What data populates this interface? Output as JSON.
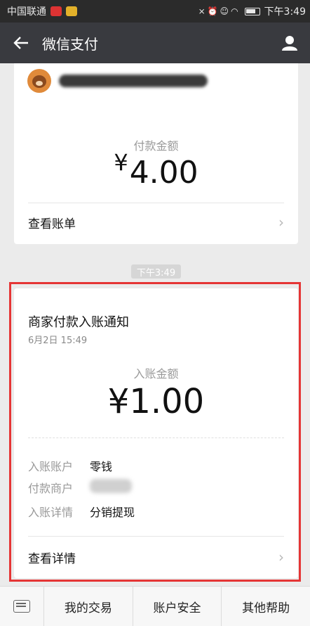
{
  "statusbar": {
    "carrier": "中国联通",
    "time": "下午3:49"
  },
  "navbar": {
    "title": "微信支付"
  },
  "card1": {
    "amount_label": "付款金额",
    "currency": "¥",
    "amount": "4.00",
    "link": "查看账单"
  },
  "time_chip": "下午3:49",
  "card2": {
    "title": "商家付款入账通知",
    "date": "6月2日  15:49",
    "amount_label": "入账金额",
    "amount": "¥1.00",
    "rows": [
      {
        "key": "入账账户",
        "value": "零钱"
      },
      {
        "key": "付款商户",
        "value": ""
      },
      {
        "key": "入账详情",
        "value": "分销提现"
      }
    ],
    "link": "查看详情"
  },
  "bottom_menu": [
    "我的交易",
    "账户安全",
    "其他帮助"
  ],
  "colors": {
    "highlight": "#e53535",
    "navbar": "#393a3f"
  }
}
